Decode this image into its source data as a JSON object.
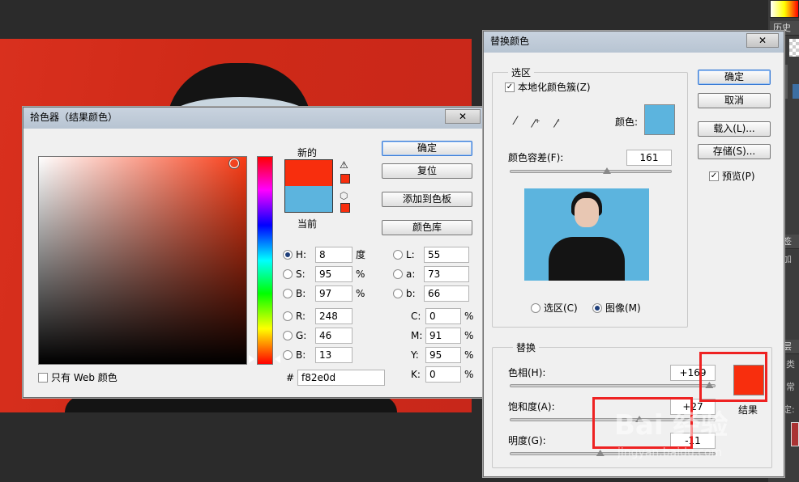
{
  "picker": {
    "title": "拾色器（结果颜色）",
    "new_label": "新的",
    "current_label": "当前",
    "new_color": "#f82e0d",
    "current_color": "#5cb4de",
    "buttons": {
      "ok": "确定",
      "reset": "复位",
      "add_swatch": "添加到色板",
      "libraries": "颜色库"
    },
    "fields": {
      "H": {
        "label": "H:",
        "value": "8",
        "unit": "度"
      },
      "S": {
        "label": "S:",
        "value": "95",
        "unit": "%"
      },
      "B": {
        "label": "B:",
        "value": "97",
        "unit": "%"
      },
      "R": {
        "label": "R:",
        "value": "248"
      },
      "G": {
        "label": "G:",
        "value": "46"
      },
      "Bl": {
        "label": "B:",
        "value": "13"
      },
      "L": {
        "label": "L:",
        "value": "55"
      },
      "a": {
        "label": "a:",
        "value": "73"
      },
      "b": {
        "label": "b:",
        "value": "66"
      },
      "C": {
        "label": "C:",
        "value": "0",
        "unit": "%"
      },
      "M": {
        "label": "M:",
        "value": "91",
        "unit": "%"
      },
      "Y": {
        "label": "Y:",
        "value": "95",
        "unit": "%"
      },
      "K": {
        "label": "K:",
        "value": "0",
        "unit": "%"
      }
    },
    "hex_label": "#",
    "hex_value": "f82e0d",
    "web_only_label": "只有 Web 颜色",
    "hue_color": "#f83a14",
    "close_glyph": "✕"
  },
  "replace": {
    "title": "替换颜色",
    "selection_group": "选区",
    "localized_label": "本地化颜色簇(Z)",
    "color_label": "颜色:",
    "selected_color": "#5cb4de",
    "fuzziness_label": "颜色容差(F):",
    "fuzziness_value": "161",
    "fuzziness_level": 0.6,
    "radio_selection": "选区(C)",
    "radio_image": "图像(M)",
    "replace_group": "替换",
    "hue_label": "色相(H):",
    "hue_value": "+169",
    "hue_level": 0.97,
    "sat_label": "饱和度(A):",
    "sat_value": "+27",
    "sat_level": 0.63,
    "light_label": "明度(G):",
    "light_value": "-11",
    "light_level": 0.44,
    "result_label": "结果",
    "result_color": "#f82e0d",
    "buttons": {
      "ok": "确定",
      "cancel": "取消",
      "load": "载入(L)...",
      "save": "存储(S)..."
    },
    "preview_label": "预览(P)",
    "close_glyph": "✕",
    "icons": [
      "eyedropper-icon",
      "eyedropper-plus-icon",
      "eyedropper-minus-icon"
    ]
  },
  "side_panel": {
    "history_label": "历史记",
    "other1": "签",
    "other2": "加",
    "other3": "层",
    "other4": "类",
    "other5": "常",
    "other6": "定:"
  },
  "watermark": "Bai 经验",
  "watermark_sub": "jingyan.baidu.com"
}
